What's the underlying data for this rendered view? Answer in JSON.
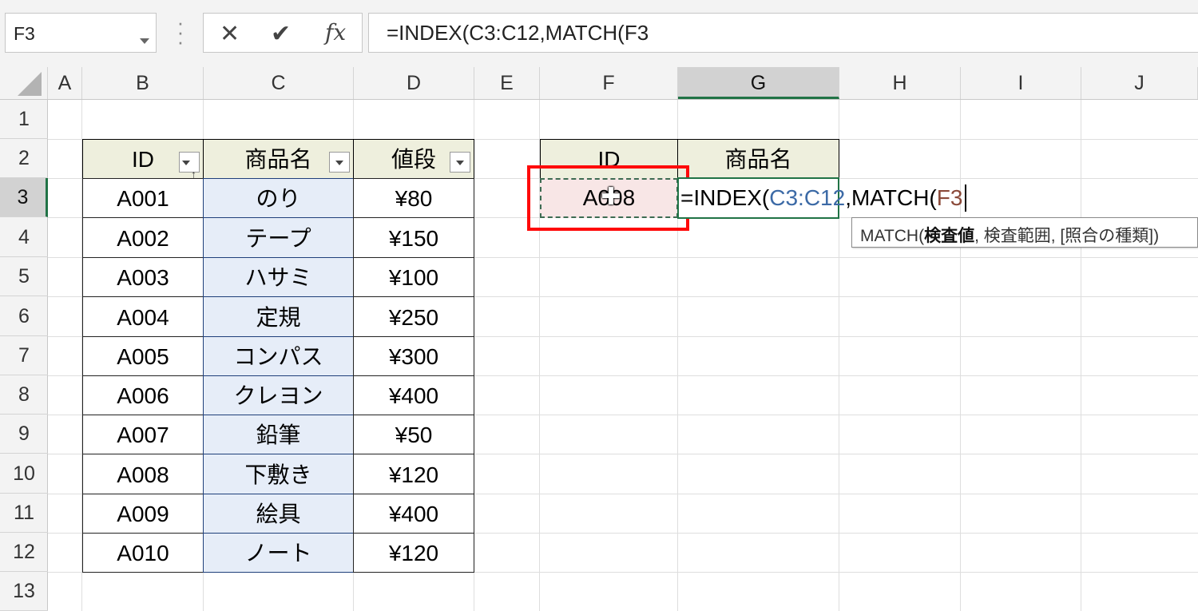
{
  "formula_bar": {
    "name_box": "F3",
    "formula": "=INDEX(C3:C12,MATCH(F3",
    "cancel_icon": "✕",
    "enter_icon": "✔",
    "fx_icon": "fx"
  },
  "columns": [
    "A",
    "B",
    "C",
    "D",
    "E",
    "F",
    "G",
    "H",
    "I",
    "J"
  ],
  "rows": [
    "1",
    "2",
    "3",
    "4",
    "5",
    "6",
    "7",
    "8",
    "9",
    "10",
    "11",
    "12",
    "13"
  ],
  "table": {
    "headers": [
      "ID",
      "商品名",
      "値段"
    ],
    "rows": [
      [
        "A001",
        "のり",
        "¥80"
      ],
      [
        "A002",
        "テープ",
        "¥150"
      ],
      [
        "A003",
        "ハサミ",
        "¥100"
      ],
      [
        "A004",
        "定規",
        "¥250"
      ],
      [
        "A005",
        "コンパス",
        "¥300"
      ],
      [
        "A006",
        "クレヨン",
        "¥400"
      ],
      [
        "A007",
        "鉛筆",
        "¥50"
      ],
      [
        "A008",
        "下敷き",
        "¥120"
      ],
      [
        "A009",
        "絵具",
        "¥400"
      ],
      [
        "A010",
        "ノート",
        "¥120"
      ]
    ]
  },
  "lookup": {
    "id_header": "ID",
    "name_header": "商品名",
    "id_value": "A008",
    "formula_prefix": "=INDEX(",
    "formula_range": "C3:C12",
    "formula_mid": ",MATCH(",
    "formula_ref": "F3"
  },
  "tooltip": {
    "fn": "MATCH(",
    "arg1": "検査値",
    "rest": ", 検査範囲, [照合の種類])"
  },
  "colors": {
    "selection_green": "#217346",
    "highlight_red": "#ff0a0a",
    "range_blue": "#3c6aa6",
    "ref_brown": "#8b4a3a"
  }
}
